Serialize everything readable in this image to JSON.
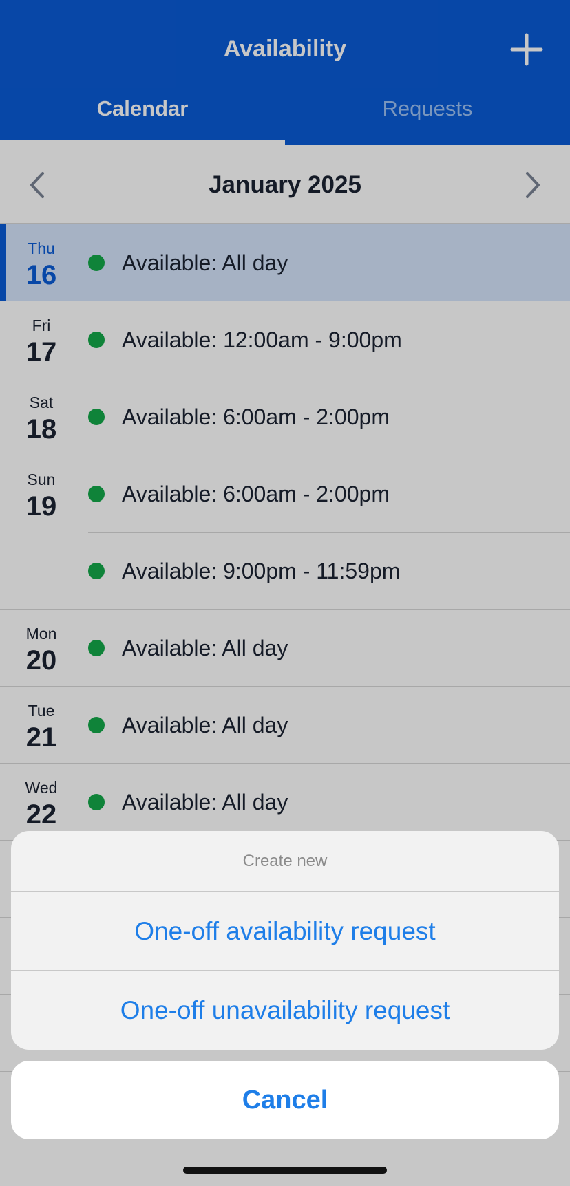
{
  "header": {
    "title": "Availability",
    "add_icon": "plus-icon",
    "tabs": [
      {
        "label": "Calendar",
        "active": true
      },
      {
        "label": "Requests",
        "active": false
      }
    ]
  },
  "month_nav": {
    "title": "January 2025",
    "prev_icon": "chevron-left-icon",
    "next_icon": "chevron-right-icon"
  },
  "days": [
    {
      "dow": "Thu",
      "num": "16",
      "selected": true,
      "entries": [
        "Available: All day"
      ]
    },
    {
      "dow": "Fri",
      "num": "17",
      "selected": false,
      "entries": [
        "Available: 12:00am - 9:00pm"
      ]
    },
    {
      "dow": "Sat",
      "num": "18",
      "selected": false,
      "entries": [
        "Available: 6:00am - 2:00pm"
      ]
    },
    {
      "dow": "Sun",
      "num": "19",
      "selected": false,
      "entries": [
        "Available: 6:00am - 2:00pm",
        "Available: 9:00pm - 11:59pm"
      ]
    },
    {
      "dow": "Mon",
      "num": "20",
      "selected": false,
      "entries": [
        "Available: All day"
      ]
    },
    {
      "dow": "Tue",
      "num": "21",
      "selected": false,
      "entries": [
        "Available: All day"
      ]
    },
    {
      "dow": "Wed",
      "num": "22",
      "selected": false,
      "entries": [
        "Available: All day"
      ]
    }
  ],
  "action_sheet": {
    "title": "Create new",
    "options": [
      "One-off availability request",
      "One-off unavailability request"
    ],
    "cancel_label": "Cancel"
  },
  "colors": {
    "brand_blue": "#0a5bd6",
    "available_green": "#14a84a",
    "action_blue": "#1e7ee8"
  }
}
